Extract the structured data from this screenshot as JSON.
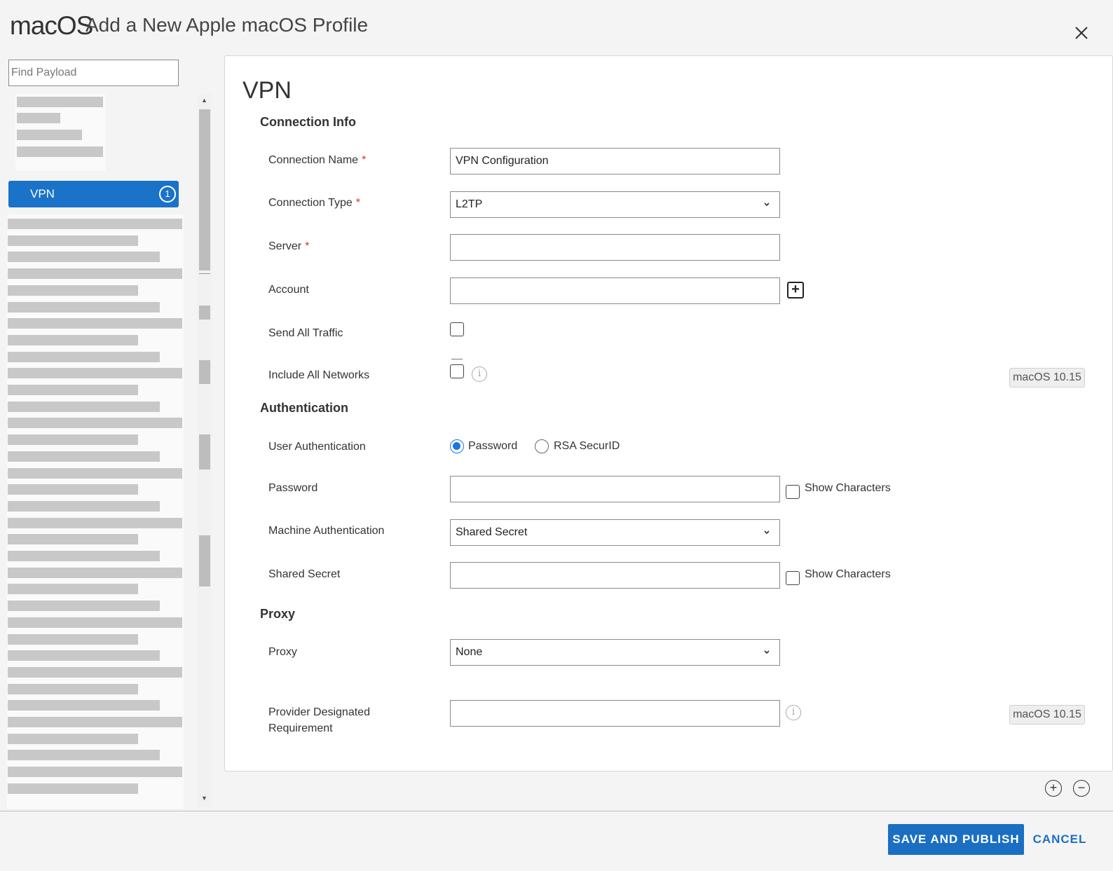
{
  "header": {
    "os_logo": "macOS",
    "title": "Add a New Apple macOS Profile",
    "close_icon": "close-icon"
  },
  "sidebar": {
    "search_placeholder": "Find Payload",
    "active_item": {
      "label": "VPN",
      "badge": "1"
    }
  },
  "panel": {
    "title": "VPN",
    "sections": {
      "connection_info": "Connection Info",
      "authentication": "Authentication",
      "proxy": "Proxy"
    },
    "fields": {
      "connection_name": {
        "label": "Connection Name",
        "required": "*",
        "value": "VPN Configuration"
      },
      "connection_type": {
        "label": "Connection Type",
        "required": "*",
        "value": "L2TP"
      },
      "server": {
        "label": "Server",
        "required": "*",
        "value": ""
      },
      "account": {
        "label": "Account",
        "value": ""
      },
      "send_all_traffic": {
        "label": "Send All Traffic",
        "checked": false
      },
      "include_all_networks": {
        "label": "Include All Networks",
        "checked": false,
        "tag": "macOS 10.15"
      },
      "user_authentication": {
        "label": "User Authentication",
        "options": [
          "Password",
          "RSA SecurID"
        ],
        "selected": "Password"
      },
      "password": {
        "label": "Password",
        "value": "",
        "show_label": "Show Characters"
      },
      "machine_authentication": {
        "label": "Machine Authentication",
        "value": "Shared Secret"
      },
      "shared_secret": {
        "label": "Shared Secret",
        "value": "",
        "show_label": "Show Characters"
      },
      "proxy": {
        "label": "Proxy",
        "value": "None"
      },
      "provider_requirement": {
        "label_line1": "Provider Designated",
        "label_line2": "Requirement",
        "value": "",
        "tag": "macOS 10.15"
      }
    }
  },
  "footer": {
    "save_label": "SAVE AND PUBLISH",
    "cancel_label": "CANCEL"
  },
  "colors": {
    "accent": "#1a6fc3",
    "active_item_bg": "#1a73c8",
    "required": "#d9342b"
  }
}
